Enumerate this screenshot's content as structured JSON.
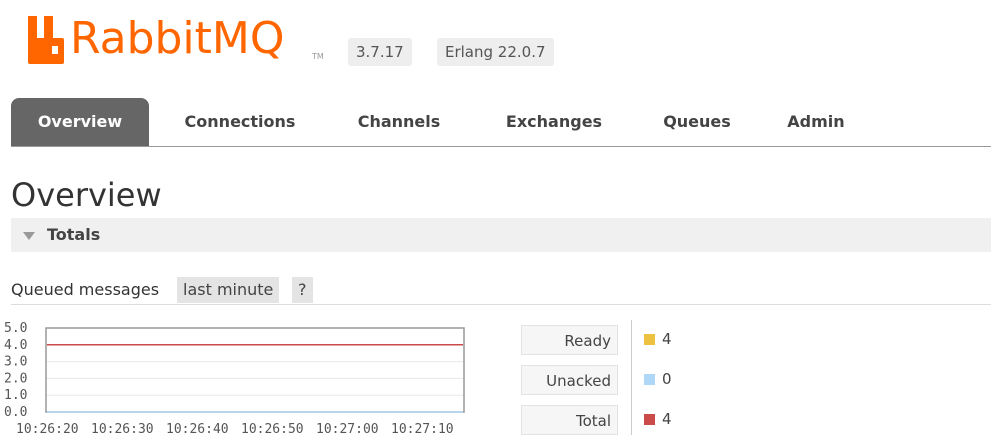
{
  "header": {
    "logo_text": "RabbitMQ",
    "logo_tm": "TM",
    "version": "3.7.17",
    "erlang": "Erlang 22.0.7"
  },
  "tabs": [
    {
      "label": "Overview",
      "active": true
    },
    {
      "label": "Connections",
      "active": false
    },
    {
      "label": "Channels",
      "active": false
    },
    {
      "label": "Exchanges",
      "active": false
    },
    {
      "label": "Queues",
      "active": false
    },
    {
      "label": "Admin",
      "active": false
    }
  ],
  "page_title": "Overview",
  "totals": {
    "label": "Totals",
    "collapsed_icon": "triangle-down-icon"
  },
  "queued_messages": {
    "label": "Queued messages",
    "range": "last minute",
    "help": "?"
  },
  "legend": [
    {
      "label": "Ready",
      "value": "4",
      "color": "#edc240"
    },
    {
      "label": "Unacked",
      "value": "0",
      "color": "#afd8f8"
    },
    {
      "label": "Total",
      "value": "4",
      "color": "#cb4b4b"
    }
  ],
  "colors": {
    "brand": "#ff6600",
    "tab_active_bg": "#666666"
  },
  "chart_data": {
    "type": "line",
    "x": [
      "10:26:20",
      "10:26:30",
      "10:26:40",
      "10:26:50",
      "10:27:00",
      "10:27:10"
    ],
    "y_ticks": [
      "5.0",
      "4.0",
      "3.0",
      "2.0",
      "1.0",
      "0.0"
    ],
    "ylim": [
      0,
      5
    ],
    "series": [
      {
        "name": "Ready",
        "values": [
          4,
          4,
          4,
          4,
          4,
          4
        ],
        "color": "#edc240"
      },
      {
        "name": "Unacked",
        "values": [
          0,
          0,
          0,
          0,
          0,
          0
        ],
        "color": "#afd8f8"
      },
      {
        "name": "Total",
        "values": [
          4,
          4,
          4,
          4,
          4,
          4
        ],
        "color": "#cb4b4b"
      }
    ],
    "grid": true
  }
}
